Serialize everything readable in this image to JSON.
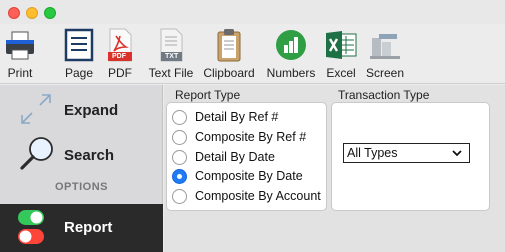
{
  "window": {
    "controls": [
      "close",
      "minimize",
      "maximize"
    ]
  },
  "toolbar": {
    "items": [
      {
        "label": "Print",
        "icon": "printer-icon"
      },
      {
        "label": "Page",
        "icon": "page-icon"
      },
      {
        "label": "PDF",
        "icon": "pdf-icon",
        "badge": "PDF"
      },
      {
        "label": "Text File",
        "icon": "text-file-icon",
        "badge": "TXT"
      },
      {
        "label": "Clipboard",
        "icon": "clipboard-icon"
      },
      {
        "label": "Numbers",
        "icon": "numbers-icon"
      },
      {
        "label": "Excel",
        "icon": "excel-icon"
      },
      {
        "label": "Screen",
        "icon": "screen-icon"
      }
    ]
  },
  "sidebar": {
    "expand_label": "Expand",
    "search_label": "Search",
    "options_heading": "OPTIONS",
    "report_label": "Report"
  },
  "report_type": {
    "title": "Report Type",
    "options": [
      {
        "label": "Detail By Ref #",
        "selected": false
      },
      {
        "label": "Composite By Ref #",
        "selected": false
      },
      {
        "label": "Detail By Date",
        "selected": false
      },
      {
        "label": "Composite By Date",
        "selected": true
      },
      {
        "label": "Composite By Account",
        "selected": false
      }
    ]
  },
  "transaction_type": {
    "title": "Transaction Type",
    "selected": "All Types"
  },
  "colors": {
    "accent": "#1f7cf6",
    "sidebar_selected": "#2a2a2a",
    "numbers_green": "#2f9e44",
    "excel_green": "#1e7145",
    "pdf_red": "#d9332b"
  }
}
